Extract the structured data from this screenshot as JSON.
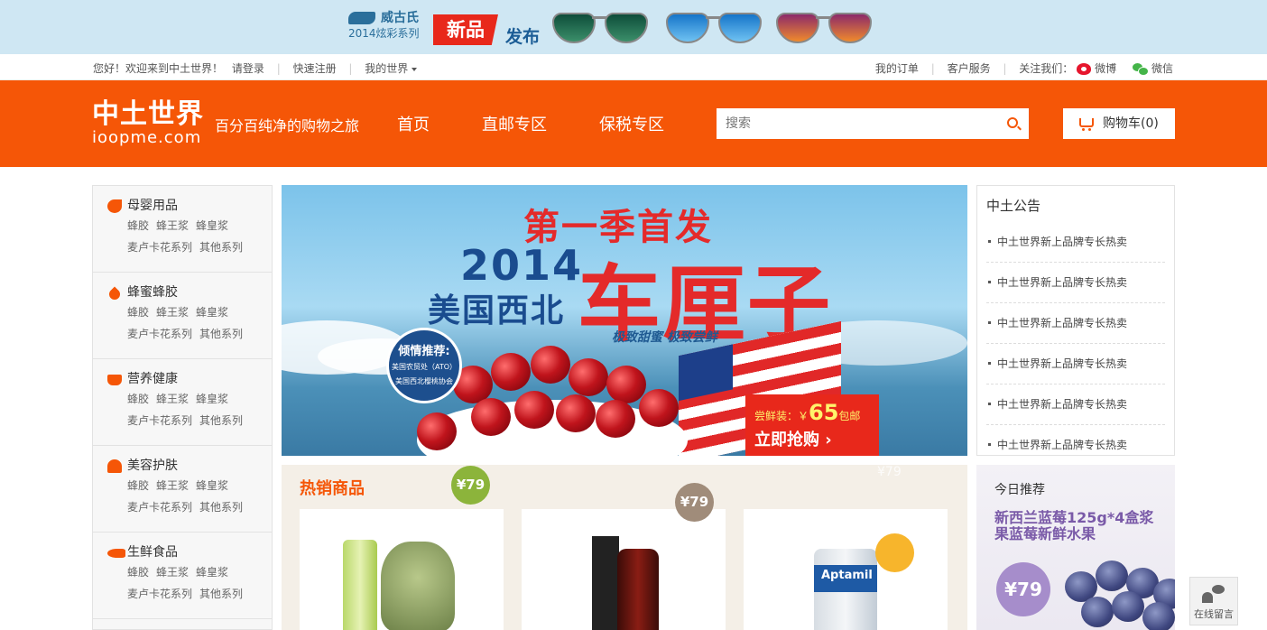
{
  "promo": {
    "brand": "威古氏",
    "series": "2014炫彩系列",
    "new_label": "新品",
    "launch_label": "发布"
  },
  "topbar": {
    "welcome": "您好！欢迎来到中土世界！",
    "login": "请登录",
    "register": "快速注册",
    "my_world": "我的世界",
    "orders": "我的订单",
    "service": "客户服务",
    "follow": "关注我们：",
    "weibo": "微博",
    "wechat": "微信"
  },
  "header": {
    "brand_cn": "中土世界",
    "brand_en": "ioopme.com",
    "tagline": "百分百纯净的购物之旅",
    "nav": [
      "首页",
      "直邮专区",
      "保税专区"
    ],
    "search_placeholder": "搜索",
    "cart_label": "购物车(0)"
  },
  "categories": [
    {
      "title": "母婴用品",
      "icon": "stroller-icon",
      "row1": [
        "蜂胶",
        "蜂王浆",
        "蜂皇浆"
      ],
      "row2": [
        "麦卢卡花系列",
        "其他系列"
      ]
    },
    {
      "title": "蜂蜜蜂胶",
      "icon": "drop-icon",
      "row1": [
        "蜂胶",
        "蜂王浆",
        "蜂皇浆"
      ],
      "row2": [
        "麦卢卡花系列",
        "其他系列"
      ]
    },
    {
      "title": "营养健康",
      "icon": "cup-icon",
      "row1": [
        "蜂胶",
        "蜂王浆",
        "蜂皇浆"
      ],
      "row2": [
        "麦卢卡花系列",
        "其他系列"
      ]
    },
    {
      "title": "美容护肤",
      "icon": "person-icon",
      "row1": [
        "蜂胶",
        "蜂王浆",
        "蜂皇浆"
      ],
      "row2": [
        "麦卢卡花系列",
        "其他系列"
      ]
    },
    {
      "title": "生鲜食品",
      "icon": "fish-icon",
      "row1": [
        "蜂胶",
        "蜂王浆",
        "蜂皇浆"
      ],
      "row2": [
        "麦卢卡花系列",
        "其他系列"
      ]
    }
  ],
  "hero": {
    "title1": "第一季首发",
    "year": "2014",
    "region": "美国西北",
    "fruit": "车厘子",
    "slogan": "极致甜蜜  极致尝鲜",
    "badge_title": "倾情推荐:",
    "badge_line1": "美国农贸处（ATO）",
    "badge_line2": "美国西北樱桃协会",
    "price_prefix": "尝鲜装：￥",
    "price_value": "65",
    "price_suffix": "包邮",
    "cta": "立即抢购 ›"
  },
  "notice": {
    "title": "中土公告",
    "items": [
      "中土世界新上品牌专长热卖",
      "中土世界新上品牌专长热卖",
      "中土世界新上品牌专长热卖",
      "中土世界新上品牌专长热卖",
      "中土世界新上品牌专长热卖",
      "中土世界新上品牌专长热卖"
    ]
  },
  "hot": {
    "title": "热销商品",
    "ghost_price": "¥79",
    "products": [
      {
        "price": "¥79",
        "badge_color": "#8cb43b"
      },
      {
        "price": "¥79",
        "badge_color": "#a08c7a"
      },
      {
        "price": "",
        "badge_color": "#f7b52c",
        "brand_text": "Aptamil"
      }
    ]
  },
  "today": {
    "title": "今日推荐",
    "desc": "新西兰蓝莓125g*4盒浆果蓝莓新鲜水果",
    "price": "¥79"
  },
  "float": {
    "online_msg": "在线留言"
  },
  "colors": {
    "brand_orange": "#f55607",
    "sidebar_bg": "#f7f7f7",
    "hot_bg": "#f4efe7",
    "today_accent": "#7a5aa8"
  }
}
